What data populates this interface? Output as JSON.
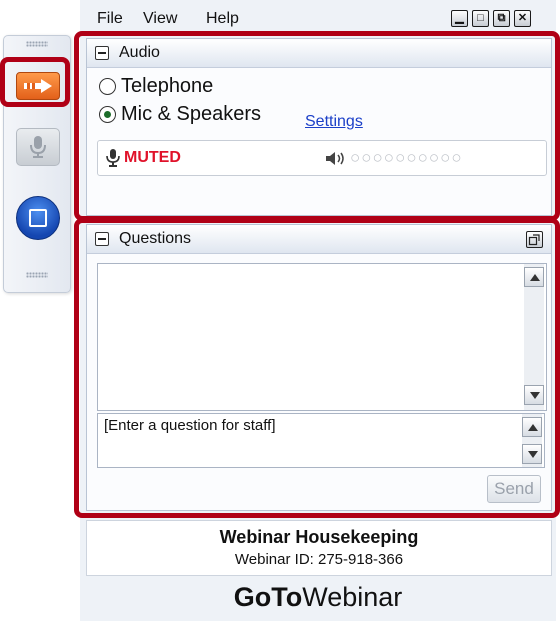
{
  "menu": {
    "file": "File",
    "view": "View",
    "help": "Help"
  },
  "window_controls": [
    "minimize-icon",
    "restore-icon",
    "popout-icon",
    "close-icon"
  ],
  "side_panel": {
    "buttons": [
      {
        "name": "show-hide-control-panel",
        "icon": "arrow-right-icon",
        "highlighted": true
      },
      {
        "name": "microphone",
        "icon": "microphone-icon",
        "enabled": false
      },
      {
        "name": "screen-share",
        "icon": "screen-icon"
      }
    ]
  },
  "audio": {
    "title": "Audio",
    "options": [
      {
        "label": "Telephone",
        "selected": false
      },
      {
        "label": "Mic & Speakers",
        "selected": true
      }
    ],
    "settings_link": "Settings",
    "status": "MUTED",
    "level_text": "○○○○○○○○○○",
    "icons": [
      "microphone-icon",
      "speaker-icon"
    ]
  },
  "questions": {
    "title": "Questions",
    "log": "",
    "input_value": "[Enter a question for staff]",
    "send_label": "Send"
  },
  "webinar": {
    "title": "Webinar Housekeeping",
    "id_text": "Webinar ID: 275-918-366"
  },
  "brand": {
    "bold": "GoTo",
    "light": "Webinar"
  },
  "colors": {
    "highlight": "#b00016",
    "muted": "#e0122a",
    "link": "#1b3fc8",
    "accent": "#e2601a"
  }
}
